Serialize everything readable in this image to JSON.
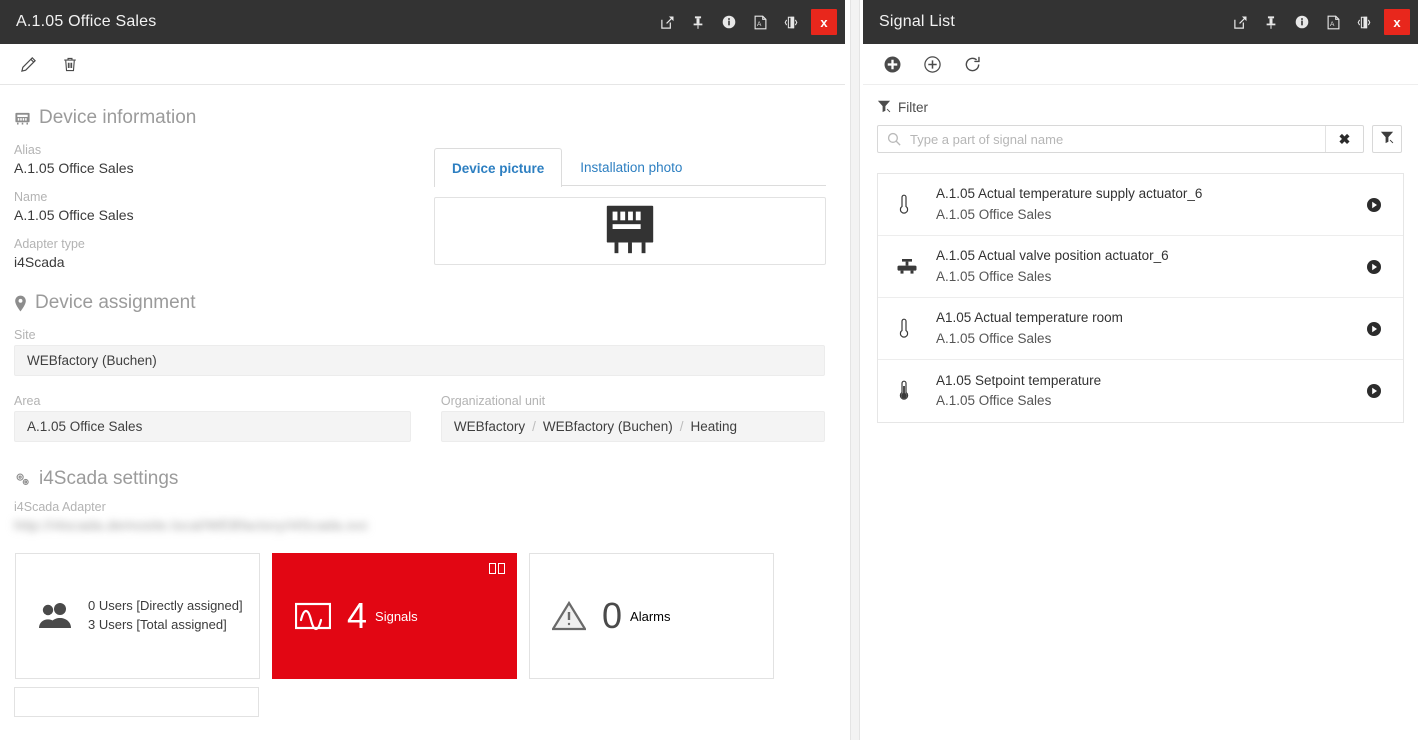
{
  "theme": {
    "titlebar_bg": "#333333",
    "accent_red": "#e20613",
    "close_red": "#e8271c",
    "link_blue": "#2d7fc1",
    "readonly_bg": "#f4f4f4"
  },
  "left_panel": {
    "title": "A.1.05 Office Sales",
    "window_icons": [
      "popout-icon",
      "pin-icon",
      "info-icon",
      "pdf-icon",
      "dock-icon",
      "close-icon"
    ],
    "close_label": "x",
    "toolbar": [
      {
        "name": "edit-button",
        "icon": "pencil-icon"
      },
      {
        "name": "delete-button",
        "icon": "trash-icon"
      }
    ],
    "device_information": {
      "heading": "Device information",
      "heading_icon": "device-chip-icon",
      "fields": [
        {
          "label": "Alias",
          "value": "A.1.05 Office Sales"
        },
        {
          "label": "Name",
          "value": "A.1.05 Office Sales"
        },
        {
          "label": "Adapter type",
          "value": "i4Scada"
        }
      ]
    },
    "picture": {
      "tabs": [
        {
          "label": "Device picture",
          "active": true
        },
        {
          "label": "Installation photo",
          "active": false
        }
      ],
      "image_icon": "chip-device-image"
    },
    "device_assignment": {
      "heading": "Device assignment",
      "heading_icon": "map-pin-icon",
      "site_label": "Site",
      "site_value": "WEBfactory (Buchen)",
      "area_label": "Area",
      "area_value": "A.1.05 Office Sales",
      "org_label": "Organizational unit",
      "org_breadcrumb": [
        "WEBfactory",
        "WEBfactory (Buchen)",
        "Heating"
      ],
      "breadcrumb_separator": "/"
    },
    "i4scada_settings": {
      "heading": "i4Scada settings",
      "heading_icon": "gears-icon",
      "adapter_label": "i4Scada Adapter",
      "adapter_value": "http://i4scada.demosite.local/WEBfactory/i4Scada.svc"
    },
    "tiles": [
      {
        "name": "users-tile",
        "icon": "users-icon",
        "line1": "0 Users [Directly assigned]",
        "line2": "3 Users [Total assigned]",
        "accent": false
      },
      {
        "name": "signals-tile",
        "icon": "waveform-icon",
        "count": "4",
        "caption": "Signals",
        "accent": true,
        "corner_icon": "columns-icon"
      },
      {
        "name": "alarms-tile",
        "icon": "warning-triangle-icon",
        "count": "0",
        "caption": "Alarms",
        "accent": false
      }
    ]
  },
  "right_panel": {
    "title": "Signal List",
    "window_icons": [
      "popout-icon",
      "pin-icon",
      "info-icon",
      "pdf-icon",
      "dock-icon",
      "close-icon"
    ],
    "close_label": "x",
    "toolbar": [
      {
        "name": "add-signal-button",
        "icon": "plus-circle-filled-icon"
      },
      {
        "name": "add-existing-signal-button",
        "icon": "plus-circle-outline-icon"
      },
      {
        "name": "refresh-button",
        "icon": "refresh-icon"
      }
    ],
    "filter": {
      "heading": "Filter",
      "heading_icon": "filter-icon",
      "search_placeholder": "Type a part of signal name",
      "search_value": "",
      "clear_label": "✖",
      "advanced_filter_icon": "filter-icon"
    },
    "signals": [
      {
        "icon": "thermometer-icon",
        "name": "A.1.05 Actual temperature supply actuator_6",
        "source": "A.1.05 Office Sales",
        "action_icon": "play-circle-icon"
      },
      {
        "icon": "valve-icon",
        "name": "A.1.05 Actual valve position actuator_6",
        "source": "A.1.05 Office Sales",
        "action_icon": "play-circle-icon"
      },
      {
        "icon": "thermometer-icon",
        "name": "A1.05 Actual temperature room",
        "source": "A.1.05 Office Sales",
        "action_icon": "play-circle-icon"
      },
      {
        "icon": "thermometer-filled-icon",
        "name": "A1.05 Setpoint temperature",
        "source": "A.1.05 Office Sales",
        "action_icon": "play-circle-icon"
      }
    ]
  }
}
